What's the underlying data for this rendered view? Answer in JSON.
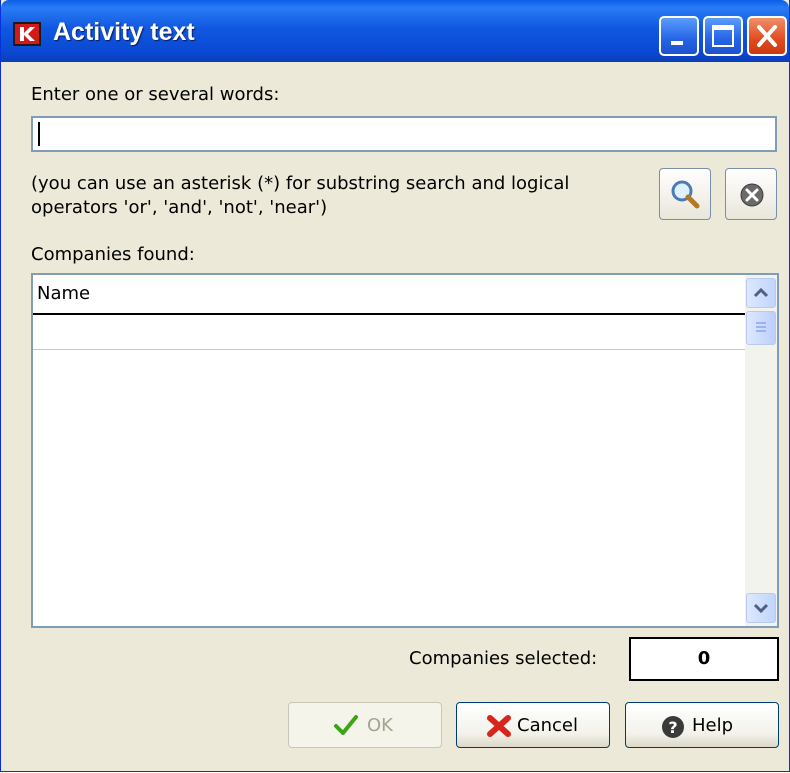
{
  "window": {
    "title": "Activity text",
    "icons": {
      "app": "app-logo-icon",
      "minimize": "minimize-icon",
      "maximize": "maximize-icon",
      "close": "close-icon"
    }
  },
  "search": {
    "label": "Enter one or several words:",
    "value": "",
    "hint_line1": "(you can use an asterisk (*) for substring search and logical",
    "hint_line2": "operators 'or', 'and', 'not', 'near')",
    "search_icon": "magnifier-icon",
    "clear_icon": "clear-circle-icon"
  },
  "results": {
    "label": "Companies found:",
    "columns": [
      "Name"
    ],
    "rows": [
      ""
    ]
  },
  "selection": {
    "label": "Companies selected:",
    "count": "0"
  },
  "buttons": {
    "ok": "OK",
    "cancel": "Cancel",
    "help": "Help"
  },
  "colors": {
    "titlebar": "#0a48d2",
    "window_bg": "#ece9d8",
    "ok_check": "#3aa617",
    "cancel_x": "#d9261c"
  }
}
